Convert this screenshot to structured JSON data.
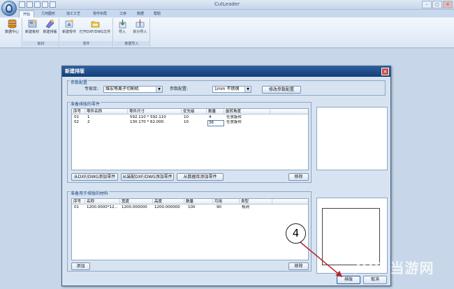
{
  "app": {
    "title": "CutLeader"
  },
  "ribbon": {
    "tabs": [
      {
        "label": "开始",
        "active": true
      },
      {
        "label": "几何图形"
      },
      {
        "label": "加工工艺"
      },
      {
        "label": "零件布局"
      },
      {
        "label": "工序"
      },
      {
        "label": "数据"
      },
      {
        "label": "帮助"
      }
    ],
    "groups": [
      {
        "label": "",
        "buttons": [
          {
            "label": "数据中心",
            "icon": "database-icon"
          }
        ]
      },
      {
        "label": "板材",
        "buttons": [
          {
            "label": "新建板材",
            "icon": "new-sheet-icon"
          },
          {
            "label": "新建排版",
            "icon": "new-nest-icon"
          }
        ]
      },
      {
        "label": "零件",
        "buttons": [
          {
            "label": "新建零件",
            "icon": "new-part-icon"
          },
          {
            "label": "打开DXF/DWG文件",
            "icon": "open-dxf-icon"
          }
        ]
      },
      {
        "label": "数据导入",
        "buttons": [
          {
            "label": "导入",
            "icon": "import-icon"
          },
          {
            "label": "拆分导入",
            "icon": "split-import-icon"
          }
        ]
      }
    ]
  },
  "dialog": {
    "title": "新建排版",
    "param_config": {
      "group_title": "参数配置",
      "expert_label": "专家库:",
      "expert_value": "维宏等离子切割机",
      "param_label": "参数配置:",
      "param_value": "1mm 不锈钢",
      "modify_button": "修改参数配置"
    },
    "parts": {
      "group_title": "准备排版的零件",
      "columns": [
        "序号",
        "零件名称",
        "零件尺寸",
        "优先级",
        "数量",
        "旋转角度"
      ],
      "rows": [
        [
          "01",
          "1",
          "592.110 * 592.110",
          "10",
          "4",
          "任意旋转"
        ],
        [
          "02",
          "2",
          "130.170 * 62.000",
          "10",
          "36",
          "任意旋转"
        ]
      ],
      "buttons": {
        "add_from_dxf": "从DXF/DWG添加零件",
        "add_from_assembly": "从装配DXF/DWG添加零件",
        "add_from_db": "从数据库添加零件",
        "remove": "移除"
      }
    },
    "materials": {
      "group_title": "准备用于排版的材料",
      "columns": [
        "序号",
        "名称",
        "宽度",
        "高度",
        "数量",
        "可用",
        "类型"
      ],
      "rows": [
        [
          "01",
          "1200.0000*12...",
          "1200.000000",
          "1200.000000",
          "100",
          "90",
          "规则"
        ]
      ],
      "buttons": {
        "add": "添加",
        "remove": "移除"
      }
    },
    "footer": {
      "nest_button": "排版",
      "cancel_button": "取消"
    }
  },
  "annotation": {
    "step": "4"
  },
  "watermark": {
    "text": "3H8 当游网"
  }
}
